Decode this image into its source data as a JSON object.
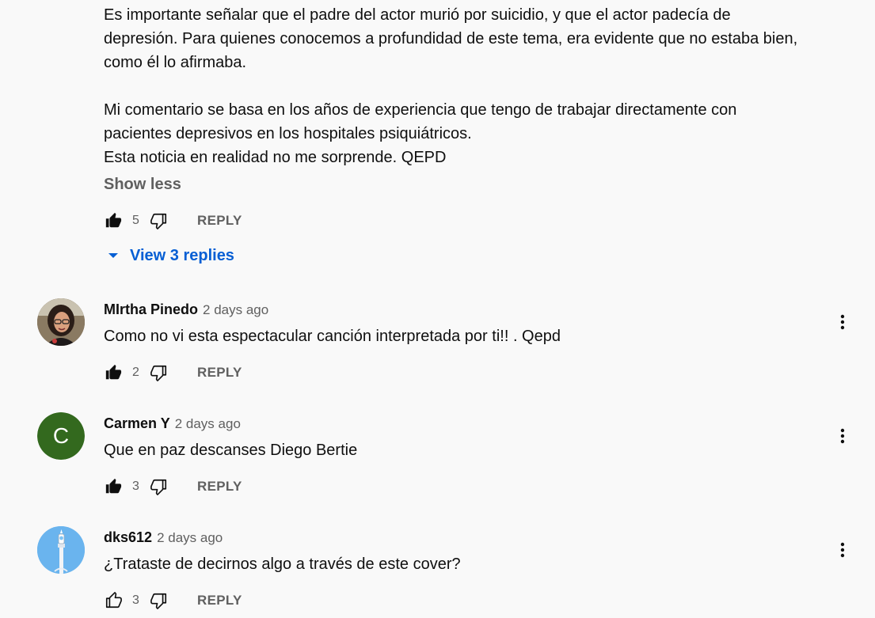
{
  "expanded_comment": {
    "paragraph1": "Es importante señalar que el padre del actor murió por suicidio, y que el actor padecía de depresión. Para quienes conocemos a profundidad de este tema, era evidente que no estaba bien, como él lo afirmaba.",
    "paragraph2_line1": "Mi comentario se basa en los años de experiencia que tengo de trabajar directamente con pacientes depresivos en los hospitales psiquiátricos.",
    "paragraph2_line2": "Esta noticia en realidad no me sorprende. QEPD",
    "show_less_label": "Show less",
    "likes": "5",
    "reply_label": "REPLY",
    "view_replies_label": "View 3 replies"
  },
  "comments": [
    {
      "author": "MIrtha Pinedo",
      "time": "2 days ago",
      "text": "Como no vi esta espectacular canción interpretada por ti!! . Qepd",
      "likes": "2",
      "reply_label": "REPLY",
      "avatar_icon": "photo-avatar",
      "liked": true
    },
    {
      "author": "Carmen Y",
      "time": "2 days ago",
      "text": "Que en paz descanses Diego Bertie",
      "likes": "3",
      "reply_label": "REPLY",
      "avatar_letter": "C",
      "avatar_color": "#33691e",
      "liked": true
    },
    {
      "author": "dks612",
      "time": "2 days ago",
      "text": "¿Trataste de decirnos algo a través de este cover?",
      "likes": "3",
      "reply_label": "REPLY",
      "avatar_icon": "wand-avatar",
      "avatar_color": "#6ab4ee",
      "liked": false
    }
  ],
  "colors": {
    "background": "#f9f9f9",
    "link_blue": "#065fd4",
    "secondary_text": "#606060"
  }
}
